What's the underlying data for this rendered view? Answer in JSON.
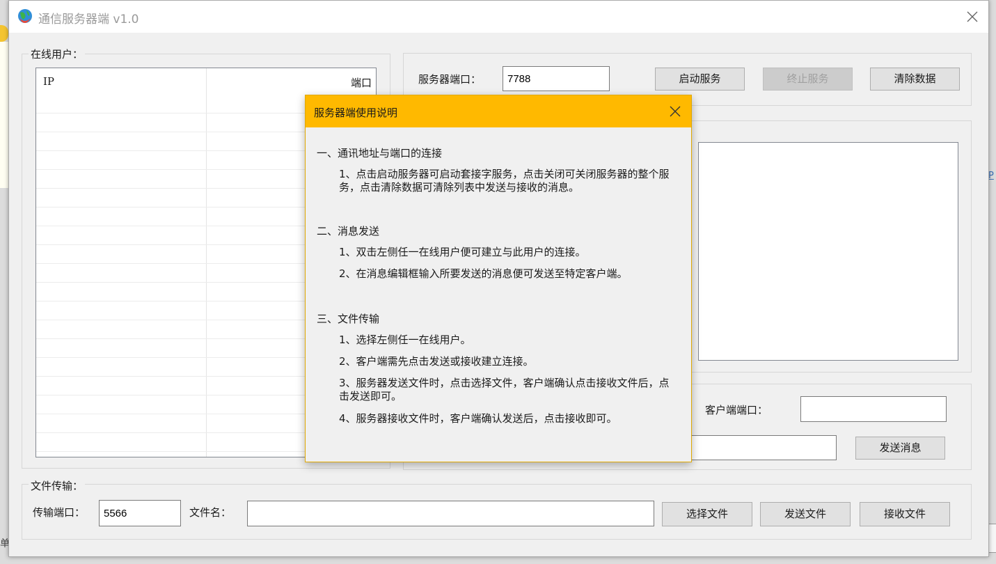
{
  "window": {
    "title": "通信服务器端 v1.0",
    "accent_color": "#ffb900"
  },
  "background": {
    "bottom_left_char": "单",
    "right_snippet": "P"
  },
  "online_users": {
    "group_label": "在线用户：",
    "columns": [
      "IP",
      "端口"
    ],
    "rows": []
  },
  "server": {
    "port_label": "服务器端口：",
    "port_value": "7788",
    "start_button": "启动服务",
    "stop_button": "终止服务",
    "clear_button": "清除数据"
  },
  "message": {
    "client_port_label": "客户端端口：",
    "client_port_value": "",
    "input_value": "",
    "send_button": "发送消息"
  },
  "file_transfer": {
    "group_label": "文件传输：",
    "port_label": "传输端口：",
    "port_value": "5566",
    "filename_label": "文件名：",
    "filename_value": "",
    "choose_button": "选择文件",
    "send_button": "发送文件",
    "receive_button": "接收文件"
  },
  "help_dialog": {
    "title": "服务器端使用说明",
    "sections": [
      {
        "heading": "一、通讯地址与端口的连接",
        "items": [
          "1、点击启动服务器可启动套接字服务，点击关闭可关闭服务器的整个服务，点击清除数据可清除列表中发送与接收的消息。"
        ]
      },
      {
        "heading": "二、消息发送",
        "items": [
          "1、双击左侧任一在线用户便可建立与此用户的连接。",
          "2、在消息编辑框输入所要发送的消息便可发送至特定客户端。"
        ]
      },
      {
        "heading": "三、文件传输",
        "items": [
          "1、选择左侧任一在线用户。",
          "2、客户端需先点击发送或接收建立连接。",
          "3、服务器发送文件时，点击选择文件，客户端确认点击接收文件后，点击发送即可。",
          "4、服务器接收文件时，客户端确认发送后，点击接收即可。"
        ]
      }
    ]
  }
}
